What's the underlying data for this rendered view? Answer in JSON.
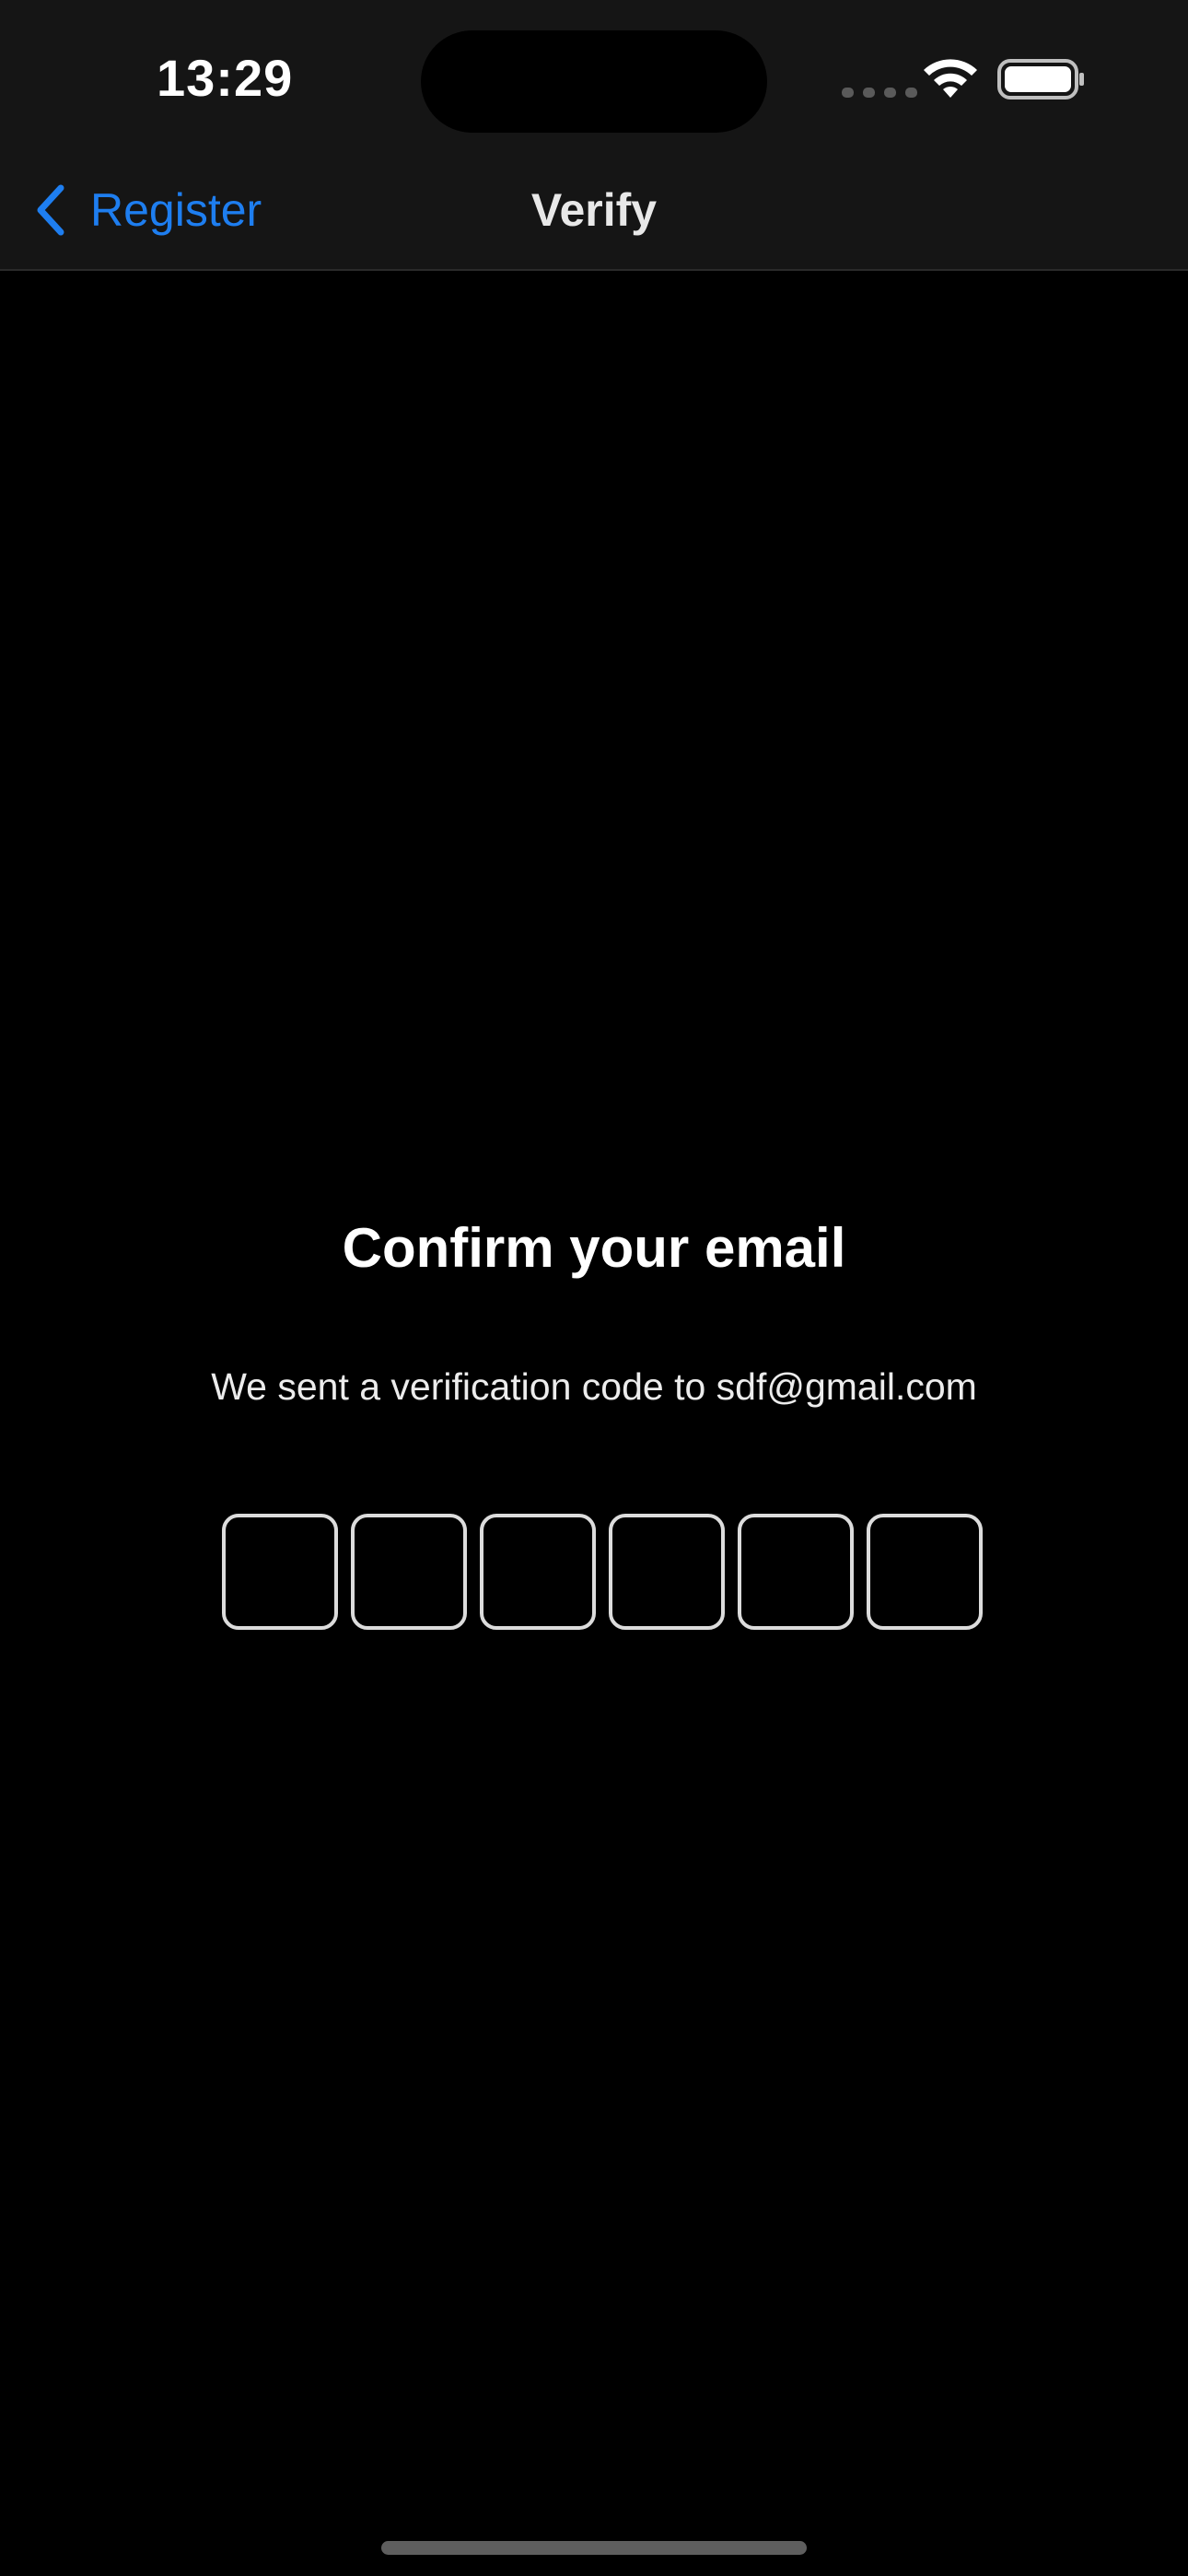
{
  "status_bar": {
    "time": "13:29",
    "wifi_icon": "wifi-icon",
    "battery_icon": "battery-icon"
  },
  "nav": {
    "back_label": "Register",
    "back_icon": "chevron-left-icon",
    "title": "Verify"
  },
  "main": {
    "title": "Confirm your email",
    "subtitle": "We sent a verification code to sdf@gmail.com",
    "code_digits": [
      "",
      "",
      "",
      "",
      "",
      ""
    ]
  },
  "colors": {
    "accent": "#1e7ef0",
    "background": "#000000",
    "header": "#151515",
    "box_border": "#dcdcdc"
  }
}
